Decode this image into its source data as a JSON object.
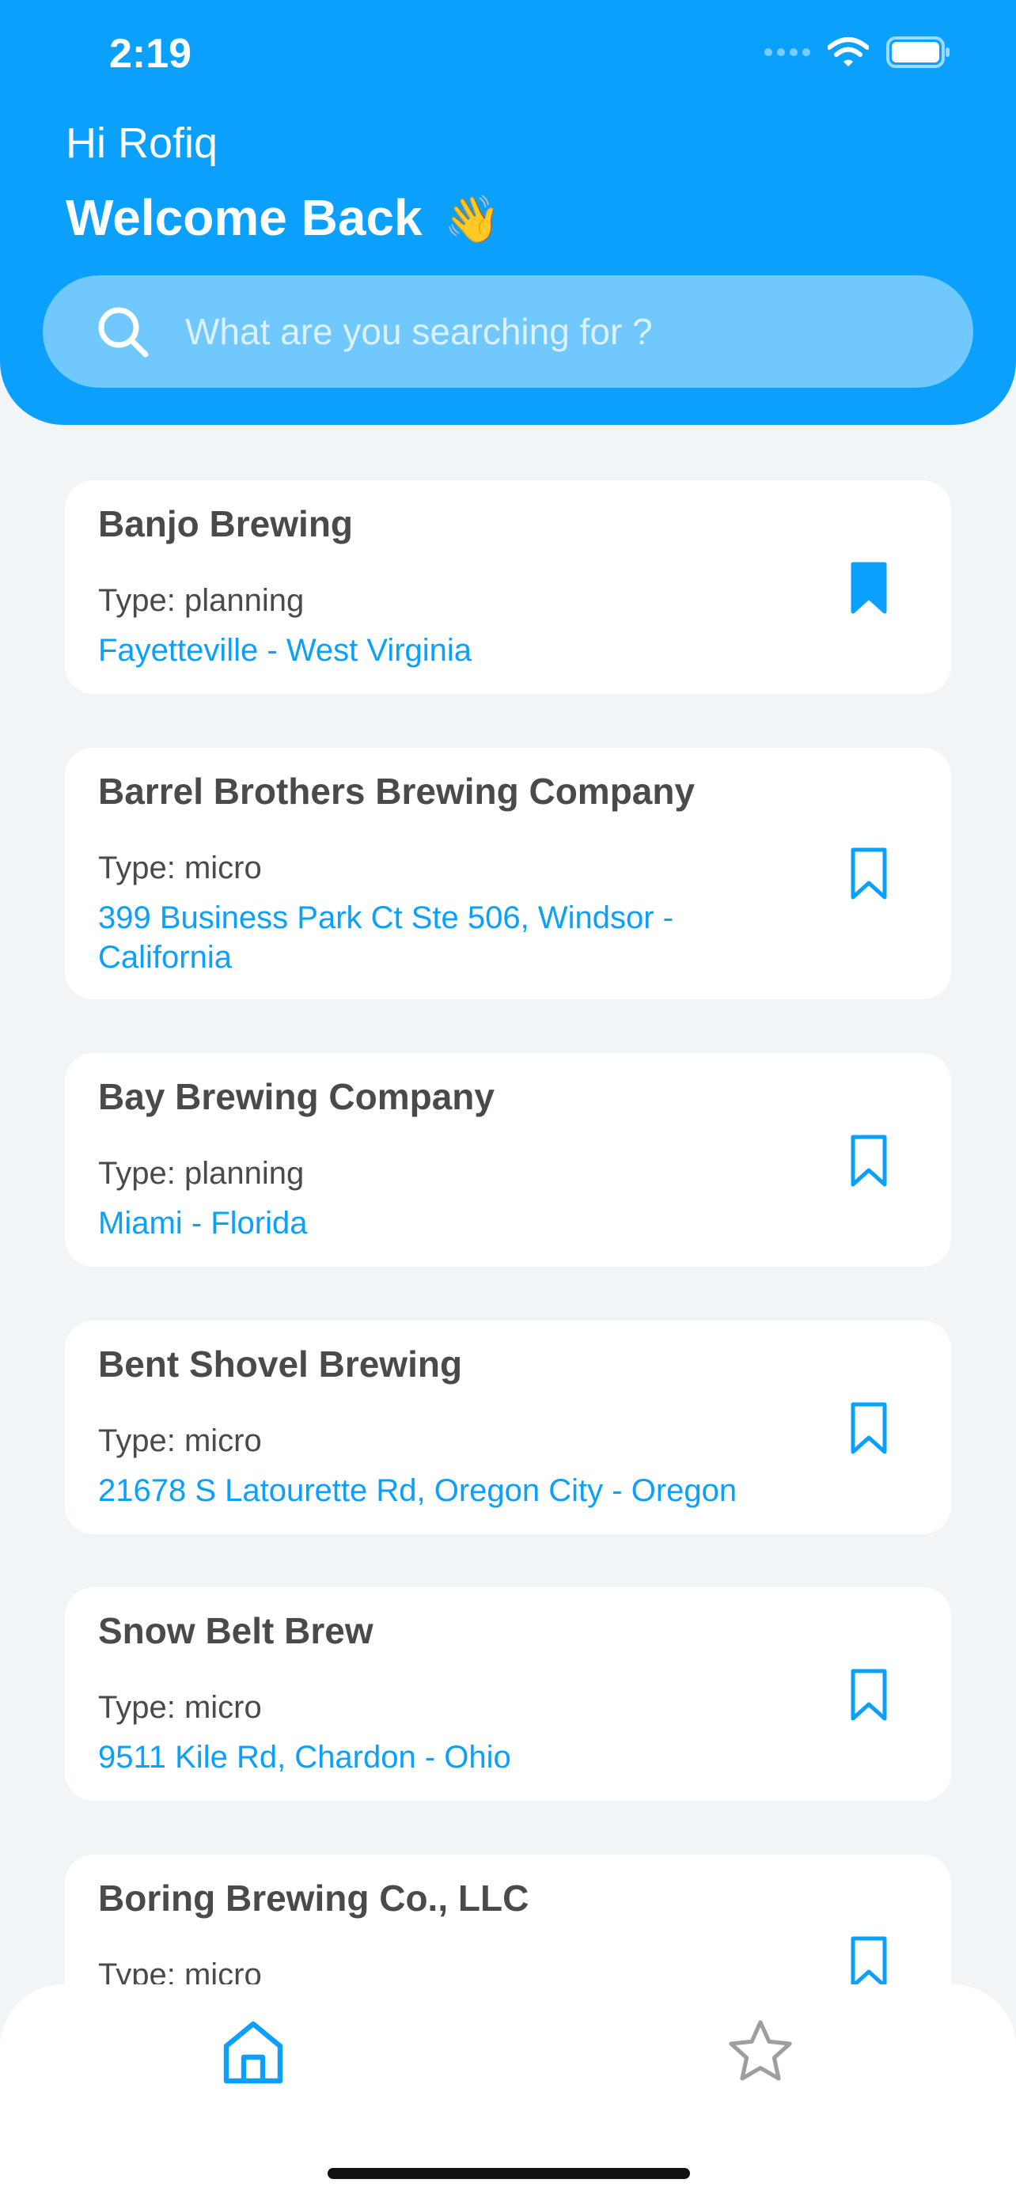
{
  "status_bar": {
    "time": "2:19"
  },
  "header": {
    "greeting": "Hi Rofiq",
    "welcome": "Welcome Back",
    "wave_emoji": "👋"
  },
  "search": {
    "placeholder": "What are you searching for ?",
    "value": ""
  },
  "breweries": [
    {
      "name": "Banjo Brewing",
      "type": "Type: planning",
      "address": "Fayetteville - West Virginia",
      "bookmarked": true
    },
    {
      "name": "Barrel Brothers Brewing Company",
      "type": "Type: micro",
      "address": "399 Business Park Ct Ste 506, Windsor - California",
      "bookmarked": false
    },
    {
      "name": "Bay Brewing Company",
      "type": "Type: planning",
      "address": "Miami - Florida",
      "bookmarked": false
    },
    {
      "name": "Bent Shovel Brewing",
      "type": "Type: micro",
      "address": "21678 S Latourette Rd, Oregon City - Oregon",
      "bookmarked": false
    },
    {
      "name": "Snow Belt Brew",
      "type": "Type: micro",
      "address": "9511 Kile Rd, Chardon - Ohio",
      "bookmarked": false
    },
    {
      "name": "Boring Brewing Co., LLC",
      "type": "Type: micro",
      "address": "",
      "bookmarked": false
    }
  ],
  "tabs": [
    {
      "icon": "home-icon",
      "active": true
    },
    {
      "icon": "star-icon",
      "active": false
    }
  ],
  "colors": {
    "accent": "#0aa0fb",
    "text": "#4a4a4a",
    "background": "#f2f5f8",
    "inactive_icon": "#9e9e9e"
  }
}
